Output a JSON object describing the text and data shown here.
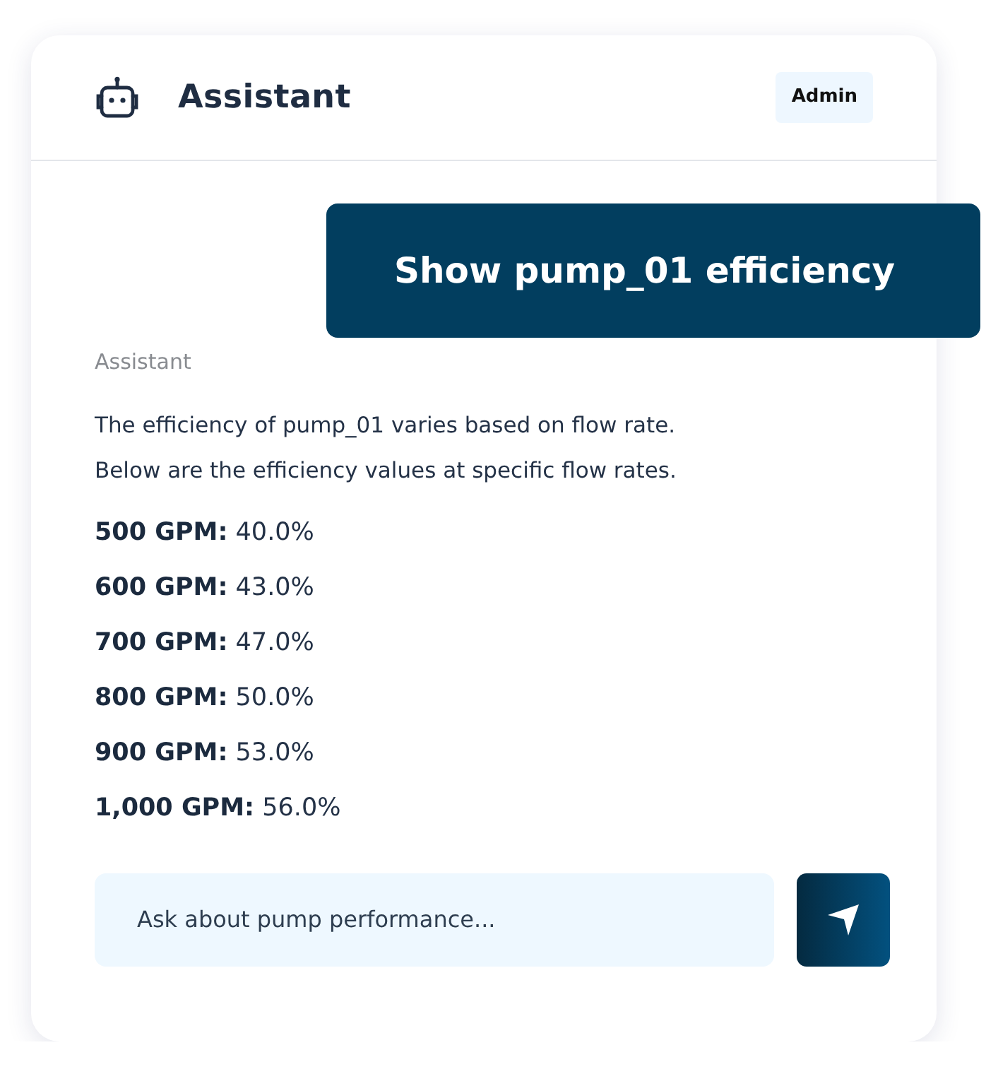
{
  "header": {
    "title": "Assistant",
    "badge": "Admin"
  },
  "messages": [
    {
      "kind": "user",
      "text": "Show pump_01 efficiency"
    },
    {
      "kind": "assistant",
      "sender": "Assistant",
      "lines": [
        "The efficiency of pump_01 varies based on flow rate.",
        "Below are the efficiency values at specific flow rates."
      ],
      "items": [
        "**500 GPM:** 40.0%",
        "**600 GPM:** 43.0%",
        "**700 GPM:** 47.0%",
        "**800 GPM:** 50.0%",
        "**900 GPM:** 53.0%",
        "**1,000 GPM:** 56.0%"
      ]
    }
  ],
  "composer": {
    "placeholder": "Ask about pump performance..."
  }
}
